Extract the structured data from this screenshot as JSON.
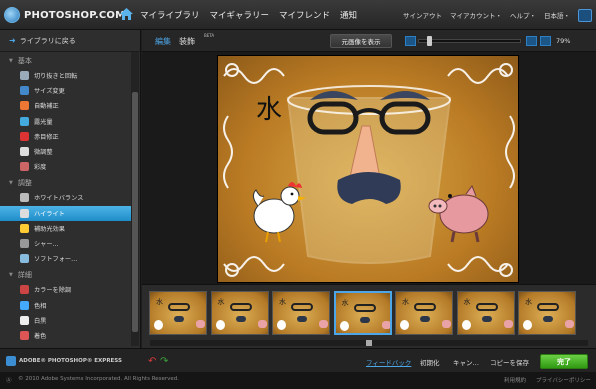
{
  "header": {
    "logo": "PHOTOSHOP.COM",
    "nav": [
      "マイライブラリ",
      "マイギャラリー",
      "マイフレンド",
      "通知"
    ],
    "utils": [
      "サインアウト",
      "マイアカウント・",
      "ヘルプ・",
      "日本語・"
    ]
  },
  "sidebar": {
    "back": "ライブラリに戻る",
    "sections": [
      {
        "title": "基本",
        "items": [
          "切り抜きと回転",
          "サイズ変更",
          "自動補正",
          "露光量",
          "赤目修正",
          "微調整",
          "彩度"
        ]
      },
      {
        "title": "調整",
        "items": [
          "ホワイトバランス",
          "ハイライト",
          "補助光効果",
          "シャー…",
          "ソフトフォー…"
        ]
      },
      {
        "title": "詳細",
        "items": [
          "カラーを除調",
          "色相",
          "白黒",
          "着色"
        ]
      }
    ],
    "selected": "ハイライト"
  },
  "editor": {
    "tab_edit": "編集",
    "tab_decorate": "装飾",
    "beta": "BETA",
    "original_button": "元画像を表示",
    "zoom": "79%",
    "zoom_level": 0.08
  },
  "photo": {
    "text": "水"
  },
  "filmstrip": {
    "count": 7,
    "selected_index": 3
  },
  "bottom": {
    "brand": "ADOBE® PHOTOSHOP® EXPRESS",
    "feedback": "フィードバック",
    "reset": "初期化",
    "cancel": "キャン…",
    "save_copy": "コピーを保存",
    "done": "完了"
  },
  "footer": {
    "copyright": "© 2010 Adobe Systems Incorporated. All Rights Reserved.",
    "terms": "利用規約",
    "privacy": "プライバシーポリシー"
  },
  "colors": {
    "accent": "#4da6e8",
    "done": "#3fae1a",
    "selected": "#2a9bd6"
  }
}
